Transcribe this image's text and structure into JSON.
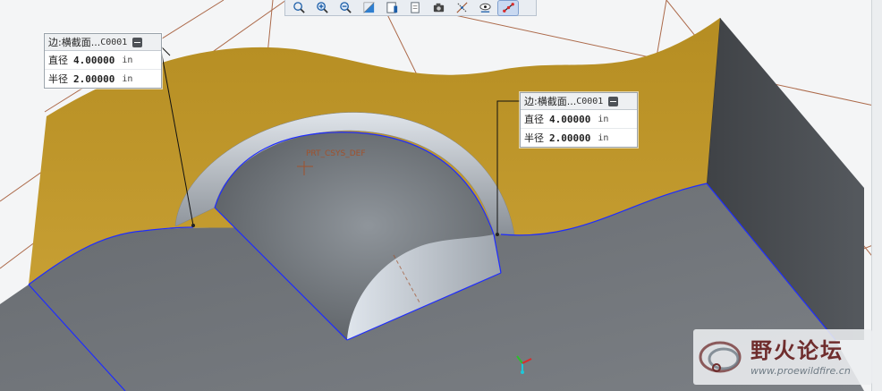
{
  "viewport": {
    "colors": {
      "background": "#f4f5f6",
      "base_top": "#6f7378",
      "wall": "#b8922a",
      "side": "#4a4d51",
      "edge_highlight": "#1e2cff",
      "reference": "#a0522d"
    },
    "csys_label": "PRT_CSYS_DEF"
  },
  "toolbar": {
    "buttons": [
      {
        "name": "zoom-fit-icon"
      },
      {
        "name": "zoom-in-icon"
      },
      {
        "name": "zoom-out-icon"
      },
      {
        "name": "repaint-icon"
      },
      {
        "name": "display-style-icon"
      },
      {
        "name": "saved-views-icon"
      },
      {
        "name": "view-manager-icon"
      },
      {
        "name": "datum-display-icon"
      },
      {
        "name": "annotation-display-icon"
      },
      {
        "name": "spin-center-icon"
      }
    ]
  },
  "callouts": [
    {
      "title": "边:横截面...",
      "id": "C0001",
      "rows": [
        {
          "label": "直径",
          "value": "4.00000",
          "unit": "in"
        },
        {
          "label": "半径",
          "value": "2.00000",
          "unit": "in"
        }
      ]
    },
    {
      "title": "边:横截面...",
      "id": "C0001",
      "rows": [
        {
          "label": "直径",
          "value": "4.00000",
          "unit": "in"
        },
        {
          "label": "半径",
          "value": "2.00000",
          "unit": "in"
        }
      ]
    }
  ],
  "watermark": {
    "text": "野火论坛",
    "url": "www.proewildfire.cn"
  }
}
